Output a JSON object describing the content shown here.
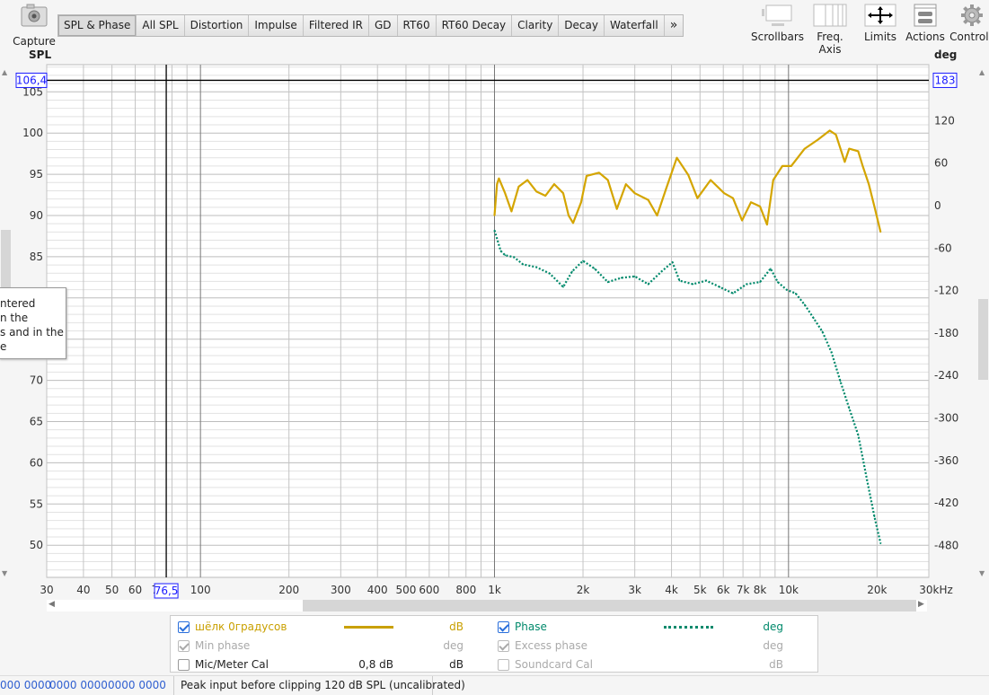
{
  "toolbar": {
    "capture_label": "Capture",
    "tabs": [
      "SPL & Phase",
      "All SPL",
      "Distortion",
      "Impulse",
      "Filtered IR",
      "GD",
      "RT60",
      "RT60 Decay",
      "Clarity",
      "Decay",
      "Waterfall"
    ],
    "more_label": "»",
    "active_tab": "SPL & Phase",
    "right_buttons": [
      {
        "label": "Scrollbars",
        "icon": "scrollbars-icon"
      },
      {
        "label": "Freq. Axis",
        "icon": "freq-axis-icon"
      },
      {
        "label": "Limits",
        "icon": "limits-arrows-icon"
      },
      {
        "label": "Actions",
        "icon": "actions-icon"
      },
      {
        "label": "Controls",
        "icon": "gear-icon"
      }
    ]
  },
  "tooltip_lines": [
    "ntered",
    "n the",
    "s and in the",
    "e"
  ],
  "chart_data": {
    "type": "line",
    "xscale": "log",
    "xlim": [
      30,
      30000
    ],
    "x_unit": "kHz",
    "x_ticks": [
      30,
      40,
      50,
      60,
      70,
      100,
      200,
      300,
      400,
      500,
      600,
      800,
      1000,
      2000,
      3000,
      4000,
      5000,
      6000,
      7000,
      8000,
      10000,
      20000,
      30000
    ],
    "x_tick_labels": [
      "30",
      "40",
      "50",
      "60",
      "7",
      "100",
      "200",
      "300",
      "400",
      "500",
      "600",
      "800",
      "1k",
      "2k",
      "3k",
      "4k",
      "5k",
      "6k",
      "7k",
      "8k",
      "10k",
      "20k",
      "30kHz"
    ],
    "left_axis": {
      "label": "SPL",
      "ylim": [
        46.1,
        108.3
      ],
      "ticks": [
        50,
        55,
        60,
        65,
        70,
        75,
        80,
        85,
        90,
        95,
        100,
        105
      ]
    },
    "right_axis": {
      "label": "deg",
      "ylim": [
        -525,
        199
      ],
      "ticks": [
        120,
        60,
        0,
        -60,
        -120,
        -180,
        -240,
        -300,
        -360,
        -420,
        -480
      ]
    },
    "grid": true,
    "cursor": {
      "freq_label": "76,5",
      "spl_label": "106,4",
      "deg_label": "183",
      "freq": 76.5,
      "spl": 106.4,
      "deg": 183
    },
    "series": [
      {
        "name": "шёлк 0градусов",
        "axis": "left",
        "color": "#d4a500",
        "style": "solid",
        "x": [
          1000,
          1020,
          1035,
          1087,
          1142,
          1208,
          1295,
          1390,
          1490,
          1597,
          1713,
          1787,
          1851,
          1971,
          2056,
          2268,
          2430,
          2607,
          2799,
          3000,
          3333,
          3573,
          3831,
          4170,
          4563,
          4899,
          5433,
          6042,
          6474,
          6951,
          7449,
          8001,
          8454,
          8874,
          9531,
          10212,
          11352,
          12594,
          13809,
          14493,
          15528,
          16074,
          17262,
          17871,
          18756,
          19593,
          20565
        ],
        "y": [
          90.0,
          93.8,
          94.5,
          92.7,
          90.5,
          93.5,
          94.3,
          92.9,
          92.4,
          93.8,
          92.7,
          90.0,
          89.1,
          91.6,
          94.8,
          95.2,
          94.3,
          90.8,
          93.8,
          92.7,
          91.9,
          90.0,
          93.2,
          97.0,
          94.9,
          92.1,
          94.3,
          92.7,
          92.1,
          89.4,
          91.6,
          91.1,
          88.9,
          94.3,
          96.0,
          96.0,
          98.1,
          99.2,
          100.3,
          99.8,
          96.5,
          98.1,
          97.8,
          96.0,
          93.8,
          91.1,
          88.0
        ]
      },
      {
        "name": "Phase",
        "axis": "right",
        "color": "#00896b",
        "style": "dotted",
        "x": [
          1000,
          1050,
          1087,
          1167,
          1250,
          1390,
          1542,
          1713,
          1837,
          1999,
          2189,
          2430,
          2700,
          3000,
          3333,
          3700,
          4029,
          4257,
          4731,
          5250,
          5835,
          6474,
          7197,
          8001,
          8691,
          9186,
          9867,
          10572,
          11352,
          12165,
          13035,
          13998,
          15000,
          16074,
          17262,
          18498,
          19593,
          20565
        ],
        "y": [
          -35,
          -64,
          -70,
          -73,
          -83,
          -87,
          -96,
          -115,
          -93,
          -78,
          -89,
          -108,
          -102,
          -100,
          -111,
          -93,
          -80,
          -106,
          -111,
          -106,
          -115,
          -124,
          -111,
          -108,
          -89,
          -108,
          -119,
          -124,
          -140,
          -159,
          -178,
          -207,
          -248,
          -286,
          -324,
          -388,
          -439,
          -477
        ]
      }
    ]
  },
  "legend": {
    "rows": [
      {
        "name": "шёлк 0градусов",
        "checked": true,
        "enabled": true,
        "unit": "dB",
        "color": "#c9a000",
        "value": ""
      },
      {
        "name": "Phase",
        "checked": true,
        "enabled": true,
        "unit": "deg",
        "color": "#00896b",
        "value": ""
      },
      {
        "name": "Min phase",
        "checked": true,
        "enabled": false,
        "unit": "deg",
        "value": ""
      },
      {
        "name": "Excess phase",
        "checked": true,
        "enabled": false,
        "unit": "deg",
        "value": ""
      },
      {
        "name": "Mic/Meter Cal",
        "checked": false,
        "enabled": true,
        "unit": "dB",
        "value": "0,8 dB"
      },
      {
        "name": "Soundcard Cal",
        "checked": false,
        "enabled": false,
        "unit": "dB",
        "value": ""
      }
    ]
  },
  "status": {
    "meters": [
      "000 0000",
      "0000 0000",
      "0000 0000"
    ],
    "message": "Peak input before clipping 120 dB SPL (uncalibrated)"
  }
}
